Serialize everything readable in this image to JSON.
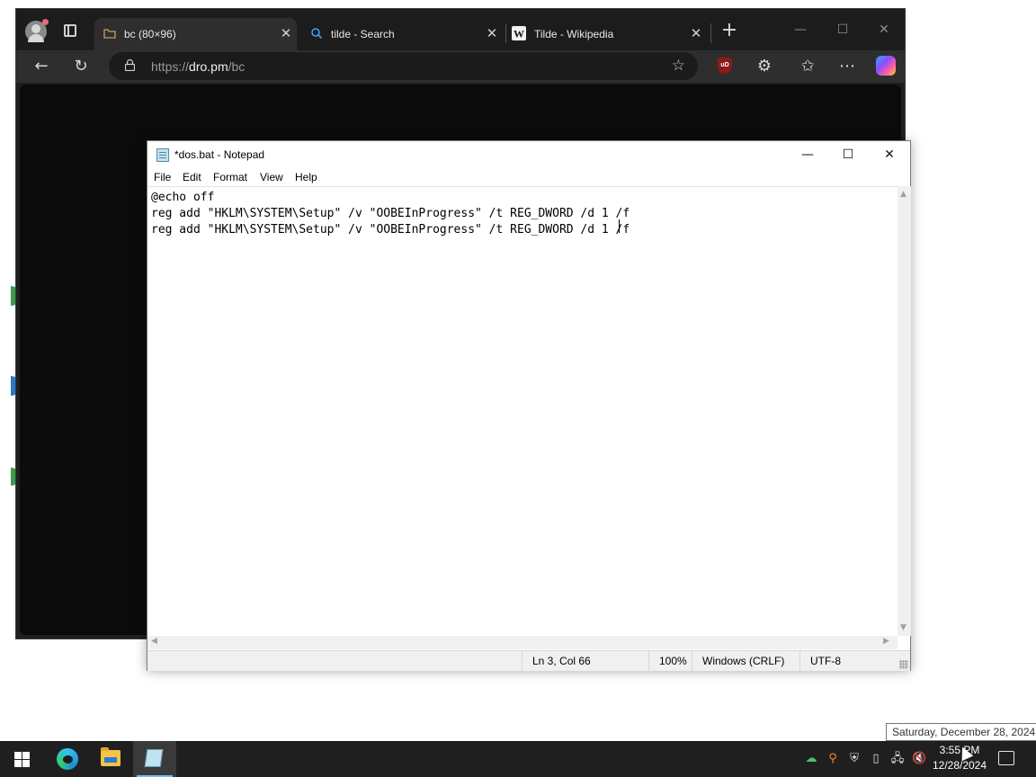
{
  "browser": {
    "tabs": [
      {
        "title": "bc (80×96)",
        "active": true
      },
      {
        "title": "tilde - Search",
        "active": false
      },
      {
        "title": "Tilde - Wikipedia",
        "active": false
      }
    ],
    "address": {
      "scheme": "https://",
      "domain": "dro.pm",
      "path": "/bc"
    },
    "extension_badge": "uD"
  },
  "notepad": {
    "title": "*dos.bat - Notepad",
    "menu": [
      "File",
      "Edit",
      "Format",
      "View",
      "Help"
    ],
    "content": "@echo off\nreg add \"HKLM\\SYSTEM\\Setup\" /v \"OOBEInProgress\" /t REG_DWORD /d 1 /f\nreg add \"HKLM\\SYSTEM\\Setup\" /v \"OOBEInProgress\" /t REG_DWORD /d 1 /f",
    "status": {
      "position": "Ln 3, Col 66",
      "zoom": "100%",
      "line_endings": "Windows (CRLF)",
      "encoding": "UTF-8"
    }
  },
  "tooltip": "Saturday, December 28, 2024",
  "taskbar": {
    "apps": [
      "Start",
      "Microsoft Edge",
      "File Explorer",
      "Notepad"
    ],
    "clock_time": "3:55 PM",
    "clock_date": "12/28/2024"
  },
  "colors": {
    "browser_bg": "#1f1f1f",
    "taskbar_bg": "#1f1f1f",
    "accent": "#76b9ed"
  }
}
